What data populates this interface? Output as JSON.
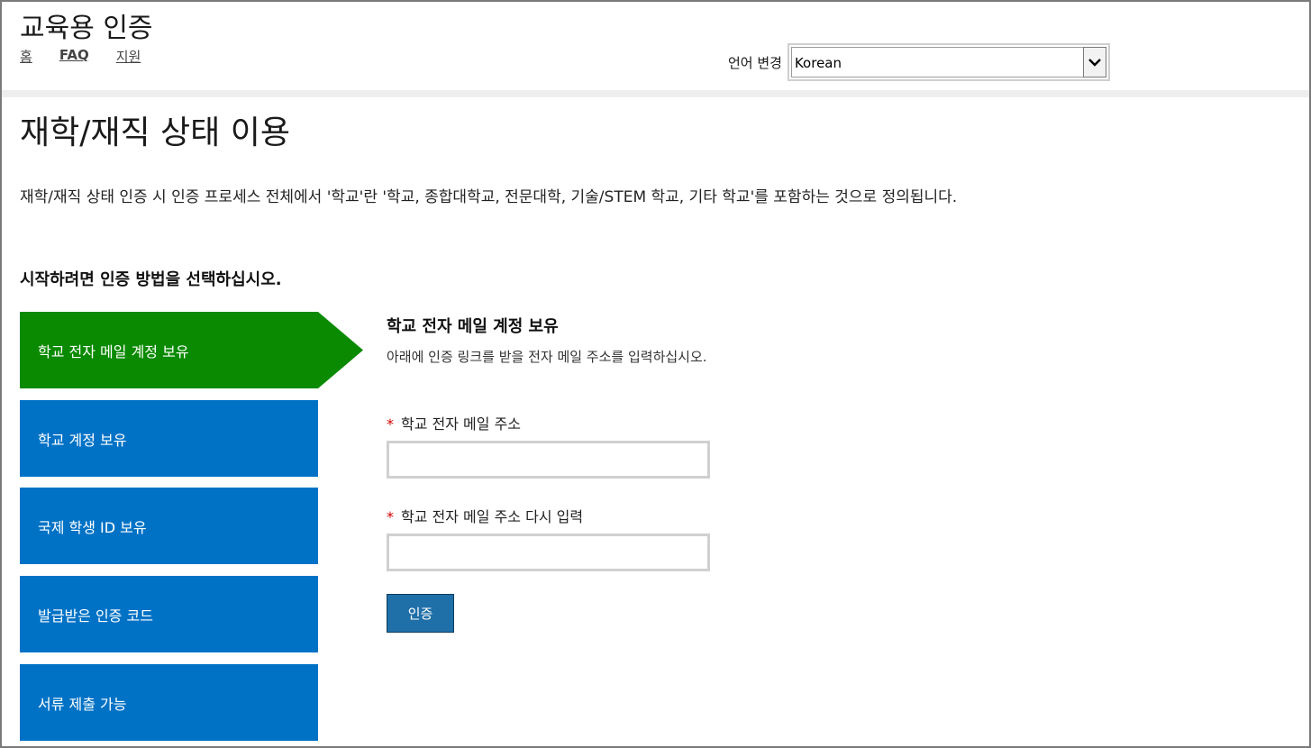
{
  "header": {
    "site_title": "교육용 인증",
    "nav": [
      {
        "label": "홈"
      },
      {
        "label": "FAQ"
      },
      {
        "label": "지원"
      }
    ],
    "language": {
      "label": "언어 변경",
      "selected": "Korean"
    }
  },
  "main": {
    "page_title": "재학/재직 상태 이용",
    "intro": "재학/재직 상태 인증 시 인증 프로세스 전체에서 '학교'란 '학교, 종합대학교, 전문대학, 기술/STEM 학교, 기타 학교'를 포함하는 것으로 정의됩니다.",
    "prompt": "시작하려면 인증 방법을 선택하십시오.",
    "methods": [
      {
        "label": "학교 전자 메일 계정 보유",
        "active": true
      },
      {
        "label": "학교 계정 보유"
      },
      {
        "label": "국제 학생 ID 보유"
      },
      {
        "label": "발급받은 인증 코드"
      },
      {
        "label": "서류 제출 가능"
      }
    ],
    "form": {
      "title": "학교 전자 메일 계정 보유",
      "subtitle": "아래에 인증 링크를 받을 전자 메일 주소를 입력하십시오.",
      "required_mark": "*",
      "email_label": "학교 전자 메일 주소",
      "email_value": "",
      "confirm_label": "학교 전자 메일 주소 다시 입력",
      "confirm_value": "",
      "submit_label": "인증"
    }
  },
  "colors": {
    "active_method": "#0a8a00",
    "method": "#0072c6",
    "button": "#1f6fa8",
    "required": "#d00000"
  },
  "icons": {
    "dropdown": "chevron-down-icon"
  }
}
